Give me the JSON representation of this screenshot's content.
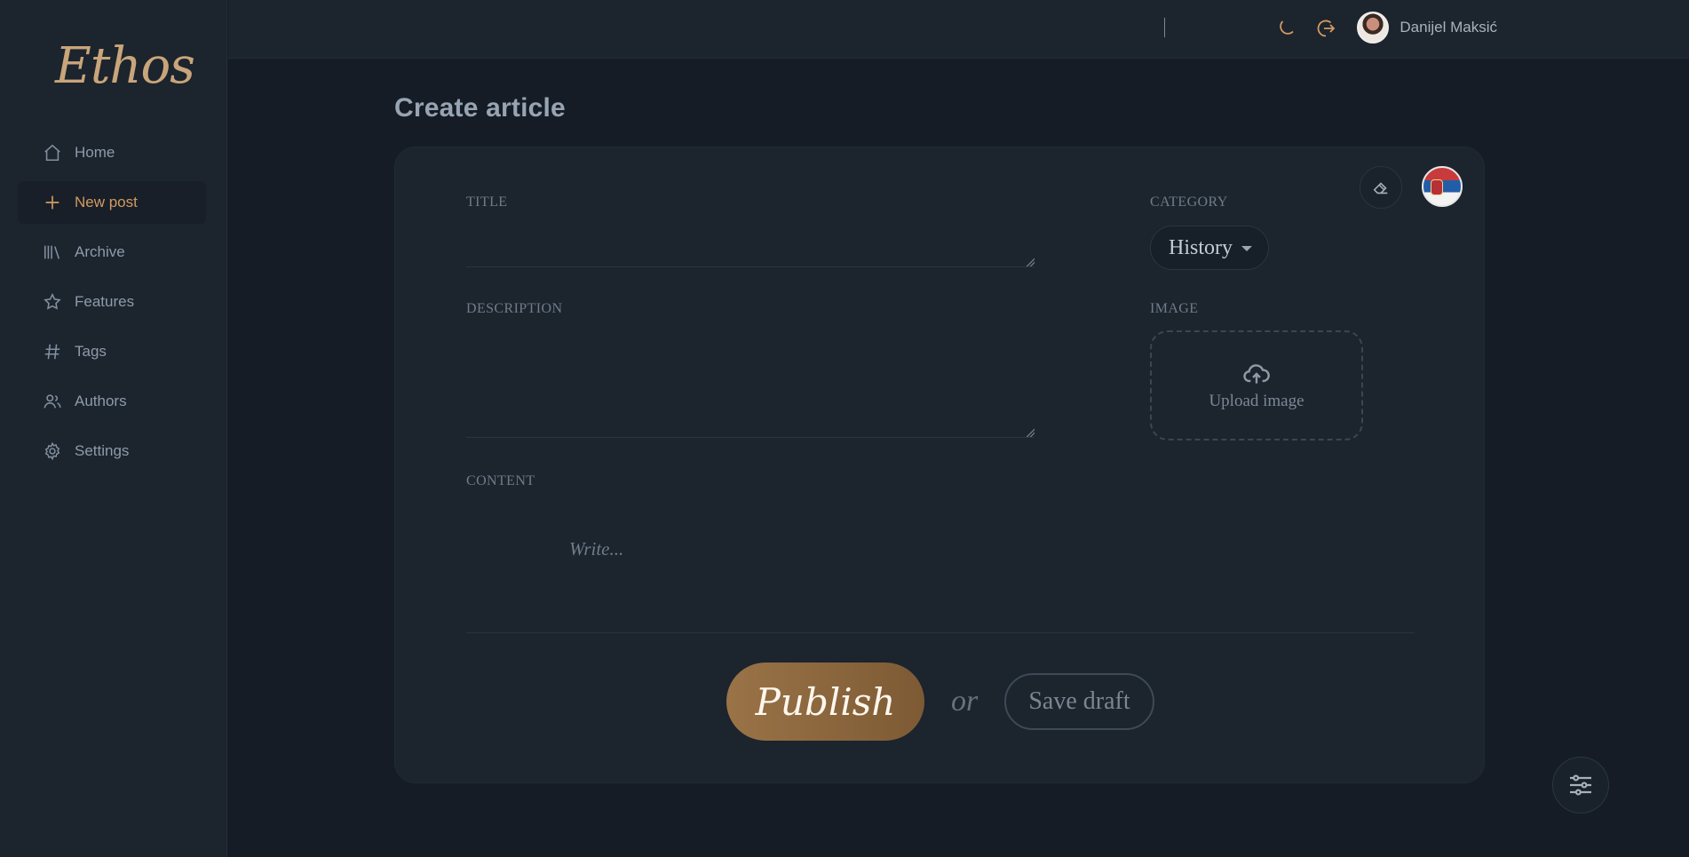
{
  "app": {
    "logo_text": "Ethos",
    "accent_color": "#d39a61"
  },
  "sidebar": {
    "items": [
      {
        "label": "Home",
        "icon": "home-icon"
      },
      {
        "label": "New post",
        "icon": "plus-icon",
        "active": true
      },
      {
        "label": "Archive",
        "icon": "archive-icon"
      },
      {
        "label": "Features",
        "icon": "star-icon"
      },
      {
        "label": "Tags",
        "icon": "hashtag-icon"
      },
      {
        "label": "Authors",
        "icon": "users-icon"
      },
      {
        "label": "Settings",
        "icon": "gear-icon"
      }
    ]
  },
  "topbar": {
    "user_name": "Danijel Maksić",
    "separator": "|",
    "theme_icon": "moon-icon",
    "logout_icon": "logout-icon"
  },
  "page": {
    "title": "Create article"
  },
  "form": {
    "title_label": "TITLE",
    "description_label": "DESCRIPTION",
    "content_label": "CONTENT",
    "content_placeholder": "Write...",
    "category_label": "CATEGORY",
    "category_value": "History",
    "image_label": "IMAGE",
    "upload_label": "Upload image",
    "clear_icon": "eraser-icon",
    "language_flag": "serbia-flag-icon"
  },
  "actions": {
    "publish_label": "Publish",
    "or_text": "or",
    "save_draft_label": "Save draft",
    "settings_icon": "sliders-icon"
  }
}
